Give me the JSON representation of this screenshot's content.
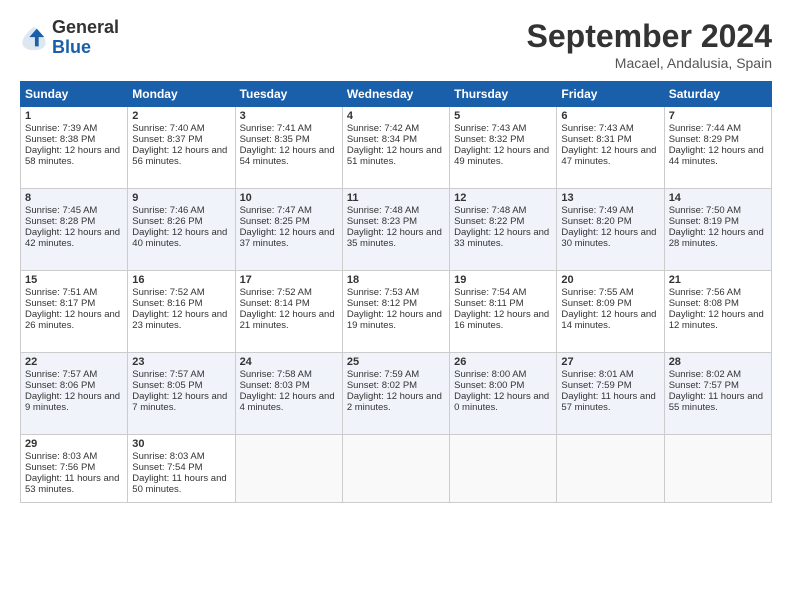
{
  "header": {
    "logo_general": "General",
    "logo_blue": "Blue",
    "month_title": "September 2024",
    "location": "Macael, Andalusia, Spain"
  },
  "weekdays": [
    "Sunday",
    "Monday",
    "Tuesday",
    "Wednesday",
    "Thursday",
    "Friday",
    "Saturday"
  ],
  "weeks": [
    [
      {
        "day": "1",
        "sunrise": "Sunrise: 7:39 AM",
        "sunset": "Sunset: 8:38 PM",
        "daylight": "Daylight: 12 hours and 58 minutes."
      },
      {
        "day": "2",
        "sunrise": "Sunrise: 7:40 AM",
        "sunset": "Sunset: 8:37 PM",
        "daylight": "Daylight: 12 hours and 56 minutes."
      },
      {
        "day": "3",
        "sunrise": "Sunrise: 7:41 AM",
        "sunset": "Sunset: 8:35 PM",
        "daylight": "Daylight: 12 hours and 54 minutes."
      },
      {
        "day": "4",
        "sunrise": "Sunrise: 7:42 AM",
        "sunset": "Sunset: 8:34 PM",
        "daylight": "Daylight: 12 hours and 51 minutes."
      },
      {
        "day": "5",
        "sunrise": "Sunrise: 7:43 AM",
        "sunset": "Sunset: 8:32 PM",
        "daylight": "Daylight: 12 hours and 49 minutes."
      },
      {
        "day": "6",
        "sunrise": "Sunrise: 7:43 AM",
        "sunset": "Sunset: 8:31 PM",
        "daylight": "Daylight: 12 hours and 47 minutes."
      },
      {
        "day": "7",
        "sunrise": "Sunrise: 7:44 AM",
        "sunset": "Sunset: 8:29 PM",
        "daylight": "Daylight: 12 hours and 44 minutes."
      }
    ],
    [
      {
        "day": "8",
        "sunrise": "Sunrise: 7:45 AM",
        "sunset": "Sunset: 8:28 PM",
        "daylight": "Daylight: 12 hours and 42 minutes."
      },
      {
        "day": "9",
        "sunrise": "Sunrise: 7:46 AM",
        "sunset": "Sunset: 8:26 PM",
        "daylight": "Daylight: 12 hours and 40 minutes."
      },
      {
        "day": "10",
        "sunrise": "Sunrise: 7:47 AM",
        "sunset": "Sunset: 8:25 PM",
        "daylight": "Daylight: 12 hours and 37 minutes."
      },
      {
        "day": "11",
        "sunrise": "Sunrise: 7:48 AM",
        "sunset": "Sunset: 8:23 PM",
        "daylight": "Daylight: 12 hours and 35 minutes."
      },
      {
        "day": "12",
        "sunrise": "Sunrise: 7:48 AM",
        "sunset": "Sunset: 8:22 PM",
        "daylight": "Daylight: 12 hours and 33 minutes."
      },
      {
        "day": "13",
        "sunrise": "Sunrise: 7:49 AM",
        "sunset": "Sunset: 8:20 PM",
        "daylight": "Daylight: 12 hours and 30 minutes."
      },
      {
        "day": "14",
        "sunrise": "Sunrise: 7:50 AM",
        "sunset": "Sunset: 8:19 PM",
        "daylight": "Daylight: 12 hours and 28 minutes."
      }
    ],
    [
      {
        "day": "15",
        "sunrise": "Sunrise: 7:51 AM",
        "sunset": "Sunset: 8:17 PM",
        "daylight": "Daylight: 12 hours and 26 minutes."
      },
      {
        "day": "16",
        "sunrise": "Sunrise: 7:52 AM",
        "sunset": "Sunset: 8:16 PM",
        "daylight": "Daylight: 12 hours and 23 minutes."
      },
      {
        "day": "17",
        "sunrise": "Sunrise: 7:52 AM",
        "sunset": "Sunset: 8:14 PM",
        "daylight": "Daylight: 12 hours and 21 minutes."
      },
      {
        "day": "18",
        "sunrise": "Sunrise: 7:53 AM",
        "sunset": "Sunset: 8:12 PM",
        "daylight": "Daylight: 12 hours and 19 minutes."
      },
      {
        "day": "19",
        "sunrise": "Sunrise: 7:54 AM",
        "sunset": "Sunset: 8:11 PM",
        "daylight": "Daylight: 12 hours and 16 minutes."
      },
      {
        "day": "20",
        "sunrise": "Sunrise: 7:55 AM",
        "sunset": "Sunset: 8:09 PM",
        "daylight": "Daylight: 12 hours and 14 minutes."
      },
      {
        "day": "21",
        "sunrise": "Sunrise: 7:56 AM",
        "sunset": "Sunset: 8:08 PM",
        "daylight": "Daylight: 12 hours and 12 minutes."
      }
    ],
    [
      {
        "day": "22",
        "sunrise": "Sunrise: 7:57 AM",
        "sunset": "Sunset: 8:06 PM",
        "daylight": "Daylight: 12 hours and 9 minutes."
      },
      {
        "day": "23",
        "sunrise": "Sunrise: 7:57 AM",
        "sunset": "Sunset: 8:05 PM",
        "daylight": "Daylight: 12 hours and 7 minutes."
      },
      {
        "day": "24",
        "sunrise": "Sunrise: 7:58 AM",
        "sunset": "Sunset: 8:03 PM",
        "daylight": "Daylight: 12 hours and 4 minutes."
      },
      {
        "day": "25",
        "sunrise": "Sunrise: 7:59 AM",
        "sunset": "Sunset: 8:02 PM",
        "daylight": "Daylight: 12 hours and 2 minutes."
      },
      {
        "day": "26",
        "sunrise": "Sunrise: 8:00 AM",
        "sunset": "Sunset: 8:00 PM",
        "daylight": "Daylight: 12 hours and 0 minutes."
      },
      {
        "day": "27",
        "sunrise": "Sunrise: 8:01 AM",
        "sunset": "Sunset: 7:59 PM",
        "daylight": "Daylight: 11 hours and 57 minutes."
      },
      {
        "day": "28",
        "sunrise": "Sunrise: 8:02 AM",
        "sunset": "Sunset: 7:57 PM",
        "daylight": "Daylight: 11 hours and 55 minutes."
      }
    ],
    [
      {
        "day": "29",
        "sunrise": "Sunrise: 8:03 AM",
        "sunset": "Sunset: 7:56 PM",
        "daylight": "Daylight: 11 hours and 53 minutes."
      },
      {
        "day": "30",
        "sunrise": "Sunrise: 8:03 AM",
        "sunset": "Sunset: 7:54 PM",
        "daylight": "Daylight: 11 hours and 50 minutes."
      },
      null,
      null,
      null,
      null,
      null
    ]
  ]
}
